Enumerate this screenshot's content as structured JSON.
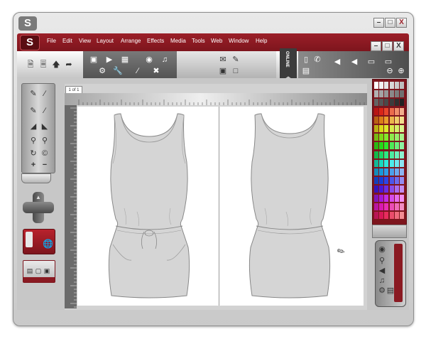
{
  "window": {
    "logo_text": "S",
    "controls": {
      "minimize": "–",
      "maximize": "□",
      "close": "X"
    }
  },
  "menubar": {
    "logo_text": "S",
    "items": [
      "File",
      "Edit",
      "View",
      "Layout",
      "Arrange",
      "Effects",
      "Media",
      "Tools",
      "Web",
      "Window",
      "Help"
    ],
    "controls": {
      "minimize": "–",
      "maximize": "□",
      "close": "X"
    }
  },
  "toolbar": {
    "online_label": "ONLINE"
  },
  "canvas": {
    "page_indicator": "1 of 1"
  },
  "colors": {
    "brand_red": "#8a1a22",
    "chrome_gray": "#c9c9c9",
    "garment_fill": "#d5d5d5",
    "garment_stroke": "#888888"
  },
  "icons": {
    "file_tools": [
      "new-document-icon",
      "open-document-icon",
      "upload-icon",
      "redo-icon"
    ],
    "media_tools": [
      "monitor-icon",
      "play-icon",
      "image-icon",
      "video-icon",
      "music-icon",
      "settings-icon",
      "wrench-icon",
      "eyedropper-icon",
      "tools-icon"
    ],
    "communication_tools": [
      "mail-icon",
      "edit-icon",
      "lock-icon",
      "unlock-icon"
    ],
    "device_tools": [
      "mobile-icon",
      "phone-icon",
      "volume-low-icon",
      "volume-high-icon",
      "window-icon",
      "battery-icon",
      "zoom-out-icon",
      "zoom-in-icon"
    ],
    "drawing_tools": [
      "pen-icon",
      "brush-icon",
      "pencil-icon",
      "eraser-icon",
      "mountain-icon",
      "landscape-icon",
      "map-pin-icon",
      "location-icon",
      "rotate-icon",
      "copyright-icon",
      "plus-icon",
      "minus-icon"
    ],
    "media_dock": [
      "camera-icon",
      "microphone-icon",
      "speaker-icon",
      "music-note-icon",
      "settings-gear-icon",
      "trash-icon",
      "film-icon"
    ]
  }
}
